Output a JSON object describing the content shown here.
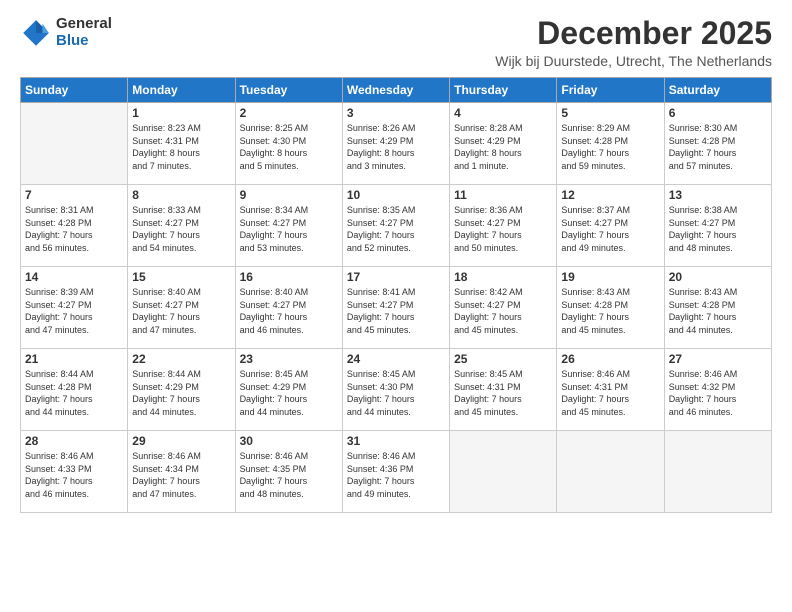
{
  "logo": {
    "general": "General",
    "blue": "Blue"
  },
  "title": "December 2025",
  "location": "Wijk bij Duurstede, Utrecht, The Netherlands",
  "days_of_week": [
    "Sunday",
    "Monday",
    "Tuesday",
    "Wednesday",
    "Thursday",
    "Friday",
    "Saturday"
  ],
  "weeks": [
    [
      {
        "day": "",
        "info": ""
      },
      {
        "day": "1",
        "info": "Sunrise: 8:23 AM\nSunset: 4:31 PM\nDaylight: 8 hours\nand 7 minutes."
      },
      {
        "day": "2",
        "info": "Sunrise: 8:25 AM\nSunset: 4:30 PM\nDaylight: 8 hours\nand 5 minutes."
      },
      {
        "day": "3",
        "info": "Sunrise: 8:26 AM\nSunset: 4:29 PM\nDaylight: 8 hours\nand 3 minutes."
      },
      {
        "day": "4",
        "info": "Sunrise: 8:28 AM\nSunset: 4:29 PM\nDaylight: 8 hours\nand 1 minute."
      },
      {
        "day": "5",
        "info": "Sunrise: 8:29 AM\nSunset: 4:28 PM\nDaylight: 7 hours\nand 59 minutes."
      },
      {
        "day": "6",
        "info": "Sunrise: 8:30 AM\nSunset: 4:28 PM\nDaylight: 7 hours\nand 57 minutes."
      }
    ],
    [
      {
        "day": "7",
        "info": "Sunrise: 8:31 AM\nSunset: 4:28 PM\nDaylight: 7 hours\nand 56 minutes."
      },
      {
        "day": "8",
        "info": "Sunrise: 8:33 AM\nSunset: 4:27 PM\nDaylight: 7 hours\nand 54 minutes."
      },
      {
        "day": "9",
        "info": "Sunrise: 8:34 AM\nSunset: 4:27 PM\nDaylight: 7 hours\nand 53 minutes."
      },
      {
        "day": "10",
        "info": "Sunrise: 8:35 AM\nSunset: 4:27 PM\nDaylight: 7 hours\nand 52 minutes."
      },
      {
        "day": "11",
        "info": "Sunrise: 8:36 AM\nSunset: 4:27 PM\nDaylight: 7 hours\nand 50 minutes."
      },
      {
        "day": "12",
        "info": "Sunrise: 8:37 AM\nSunset: 4:27 PM\nDaylight: 7 hours\nand 49 minutes."
      },
      {
        "day": "13",
        "info": "Sunrise: 8:38 AM\nSunset: 4:27 PM\nDaylight: 7 hours\nand 48 minutes."
      }
    ],
    [
      {
        "day": "14",
        "info": "Sunrise: 8:39 AM\nSunset: 4:27 PM\nDaylight: 7 hours\nand 47 minutes."
      },
      {
        "day": "15",
        "info": "Sunrise: 8:40 AM\nSunset: 4:27 PM\nDaylight: 7 hours\nand 47 minutes."
      },
      {
        "day": "16",
        "info": "Sunrise: 8:40 AM\nSunset: 4:27 PM\nDaylight: 7 hours\nand 46 minutes."
      },
      {
        "day": "17",
        "info": "Sunrise: 8:41 AM\nSunset: 4:27 PM\nDaylight: 7 hours\nand 45 minutes."
      },
      {
        "day": "18",
        "info": "Sunrise: 8:42 AM\nSunset: 4:27 PM\nDaylight: 7 hours\nand 45 minutes."
      },
      {
        "day": "19",
        "info": "Sunrise: 8:43 AM\nSunset: 4:28 PM\nDaylight: 7 hours\nand 45 minutes."
      },
      {
        "day": "20",
        "info": "Sunrise: 8:43 AM\nSunset: 4:28 PM\nDaylight: 7 hours\nand 44 minutes."
      }
    ],
    [
      {
        "day": "21",
        "info": "Sunrise: 8:44 AM\nSunset: 4:28 PM\nDaylight: 7 hours\nand 44 minutes."
      },
      {
        "day": "22",
        "info": "Sunrise: 8:44 AM\nSunset: 4:29 PM\nDaylight: 7 hours\nand 44 minutes."
      },
      {
        "day": "23",
        "info": "Sunrise: 8:45 AM\nSunset: 4:29 PM\nDaylight: 7 hours\nand 44 minutes."
      },
      {
        "day": "24",
        "info": "Sunrise: 8:45 AM\nSunset: 4:30 PM\nDaylight: 7 hours\nand 44 minutes."
      },
      {
        "day": "25",
        "info": "Sunrise: 8:45 AM\nSunset: 4:31 PM\nDaylight: 7 hours\nand 45 minutes."
      },
      {
        "day": "26",
        "info": "Sunrise: 8:46 AM\nSunset: 4:31 PM\nDaylight: 7 hours\nand 45 minutes."
      },
      {
        "day": "27",
        "info": "Sunrise: 8:46 AM\nSunset: 4:32 PM\nDaylight: 7 hours\nand 46 minutes."
      }
    ],
    [
      {
        "day": "28",
        "info": "Sunrise: 8:46 AM\nSunset: 4:33 PM\nDaylight: 7 hours\nand 46 minutes."
      },
      {
        "day": "29",
        "info": "Sunrise: 8:46 AM\nSunset: 4:34 PM\nDaylight: 7 hours\nand 47 minutes."
      },
      {
        "day": "30",
        "info": "Sunrise: 8:46 AM\nSunset: 4:35 PM\nDaylight: 7 hours\nand 48 minutes."
      },
      {
        "day": "31",
        "info": "Sunrise: 8:46 AM\nSunset: 4:36 PM\nDaylight: 7 hours\nand 49 minutes."
      },
      {
        "day": "",
        "info": ""
      },
      {
        "day": "",
        "info": ""
      },
      {
        "day": "",
        "info": ""
      }
    ]
  ]
}
